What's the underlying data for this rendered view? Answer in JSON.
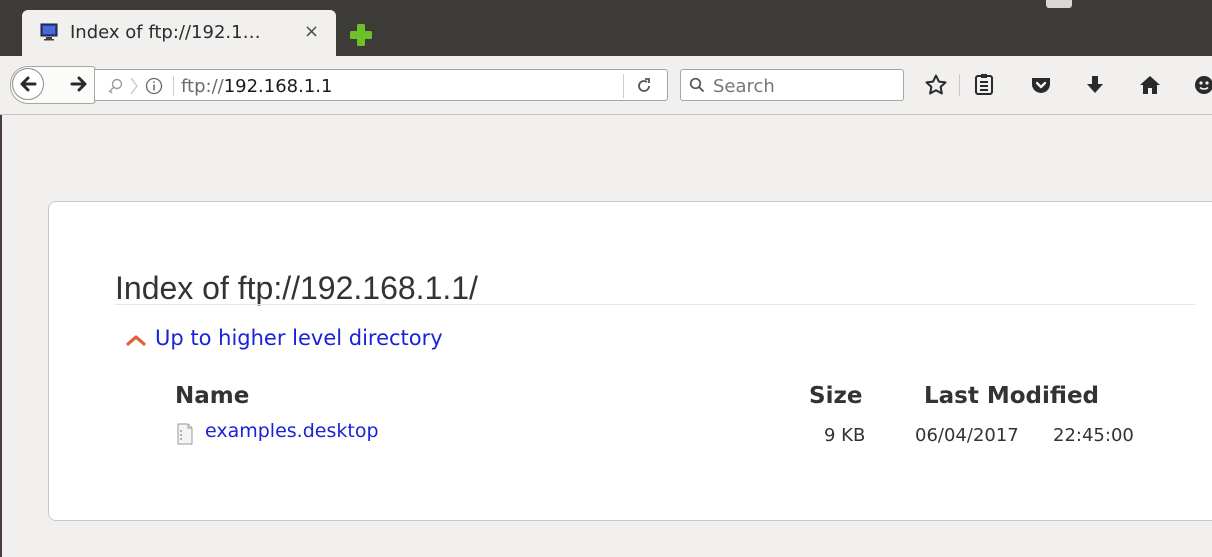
{
  "browser": {
    "tab": {
      "title": "Index of ftp://192.1…",
      "close_glyph": "×"
    },
    "url": {
      "scheme": "ftp://",
      "host": "192.168.1.1"
    },
    "search": {
      "placeholder": "Search"
    },
    "toolbar_icons": [
      "bookmark-star-icon",
      "reader-list-icon",
      "pocket-icon",
      "download-arrow-icon",
      "home-icon",
      "smiley-icon"
    ]
  },
  "page": {
    "title": "Index of ftp://192.168.1.1/",
    "up_link": "Up to higher level directory",
    "columns": {
      "name": "Name",
      "size": "Size",
      "modified": "Last Modified"
    },
    "files": [
      {
        "name": "examples.desktop",
        "size": "9 KB",
        "date": "06/04/2017",
        "time": "22:45:00"
      }
    ]
  },
  "colors": {
    "link": "#1a22d8",
    "tabstrip": "#3c3b37",
    "toolbar": "#f1f0ee",
    "up_arrow": "#e0603a",
    "newtab_plus": "#6cc12a"
  }
}
